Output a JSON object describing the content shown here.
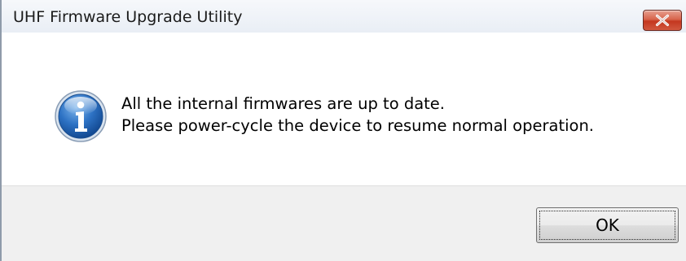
{
  "window": {
    "title": "UHF Firmware Upgrade Utility"
  },
  "dialog": {
    "icon": "info-icon",
    "message_line1": "All the internal firmwares are up to date.",
    "message_line2": "Please power-cycle the device to resume normal operation."
  },
  "buttons": {
    "ok_label": "OK",
    "close_icon": "close-icon"
  },
  "colors": {
    "close_button": "#c4371f",
    "info_icon": "#1f5ea8",
    "footer_background": "#f0f0f0"
  }
}
